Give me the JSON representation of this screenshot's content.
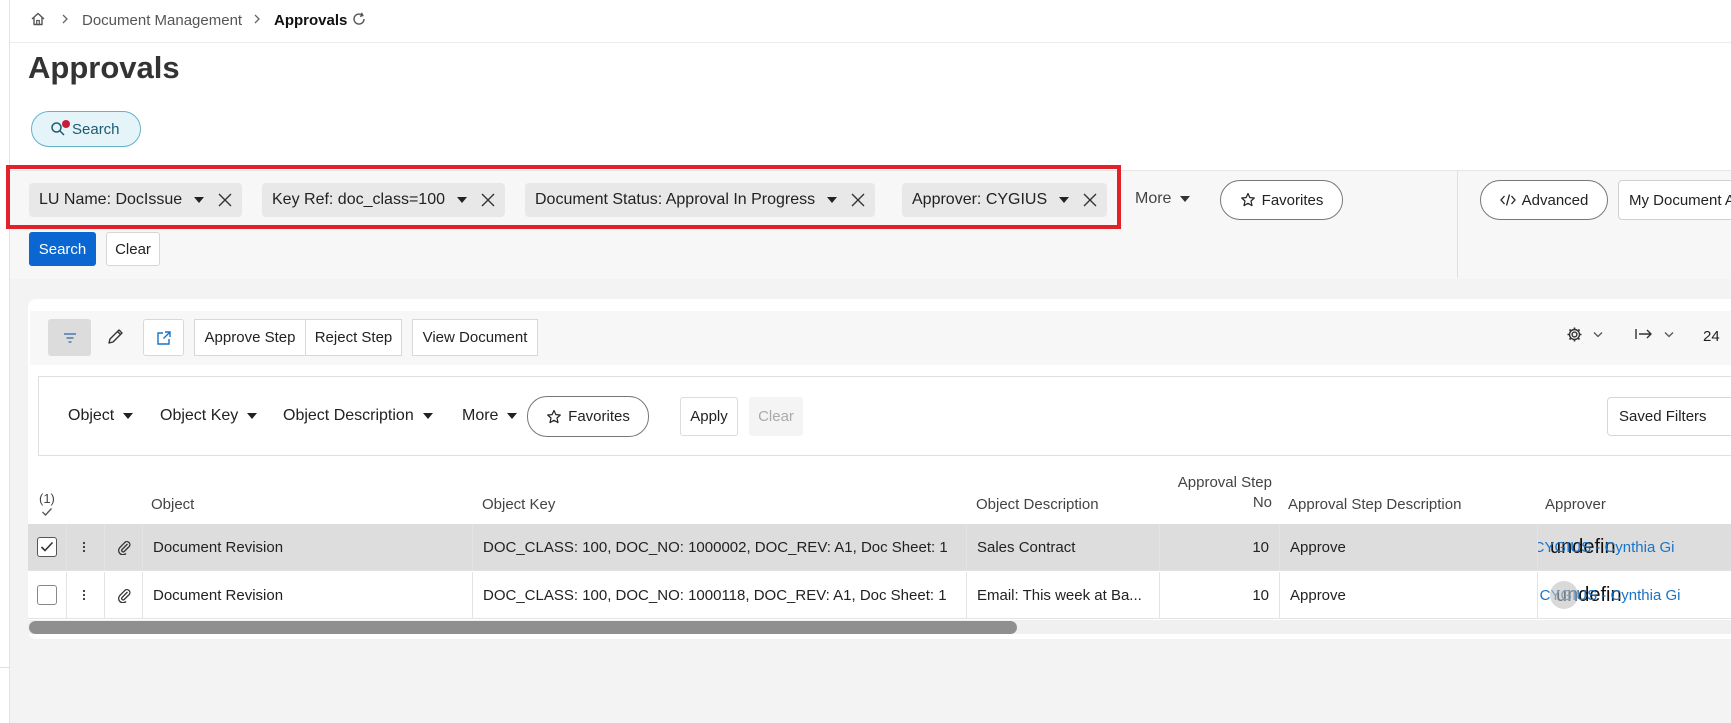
{
  "breadcrumb": {
    "home_icon": "home-icon",
    "items": [
      "Document Management",
      "Approvals"
    ],
    "refresh_icon": "refresh-icon"
  },
  "page": {
    "title": "Approvals"
  },
  "search_toggle": {
    "label": "Search",
    "has_indicator": true
  },
  "filters": {
    "chips": [
      {
        "label": "LU Name: DocIssue"
      },
      {
        "label": "Key Ref: doc_class=100"
      },
      {
        "label": "Document Status: Approval In Progress"
      },
      {
        "label": "Approver: CYGIUS"
      }
    ],
    "more_label": "More",
    "favorites_label": "Favorites",
    "advanced_label": "Advanced",
    "my_document_label": "My Document A",
    "search_label": "Search",
    "clear_label": "Clear"
  },
  "toolbar": {
    "approve_step": "Approve Step",
    "reject_step": "Reject Step",
    "view_document": "View Document",
    "record_count": "24"
  },
  "table_filters": {
    "dropdowns": [
      "Object",
      "Object Key",
      "Object Description",
      "More"
    ],
    "favorites_label": "Favorites",
    "apply_label": "Apply",
    "clear_label": "Clear",
    "saved_filters_label": "Saved Filters"
  },
  "table": {
    "selected_count": "(1)",
    "columns": {
      "object": "Object",
      "object_key": "Object Key",
      "object_description": "Object Description",
      "approval_step_no_line1": "Approval Step",
      "approval_step_no_line2": "No",
      "approval_step_description": "Approval Step Description",
      "approver": "Approver"
    },
    "rows": [
      {
        "selected": true,
        "object": "Document Revision",
        "object_key": "DOC_CLASS: 100, DOC_NO: 1000002, DOC_REV: A1, Doc Sheet: 1",
        "object_description": "Sales Contract",
        "approval_step_no": "10",
        "approval_step_description": "Approve",
        "approver_image_alt": "undefin",
        "approver_link": "CYGIUS - Cynthia Gi"
      },
      {
        "selected": false,
        "object": "Document Revision",
        "object_key": "DOC_CLASS: 100, DOC_NO: 1000118, DOC_REV: A1, Doc Sheet: 1",
        "object_description": "Email: This week at Ba...",
        "approval_step_no": "10",
        "approval_step_description": "Approve",
        "approver_image_alt": "undefin",
        "approver_link": "CYGIUS - Cynthia Gi"
      }
    ]
  },
  "colors": {
    "primary": "#0a66d1",
    "highlight_box": "#e2212b",
    "link": "#1a73c6",
    "search_toggle_bg": "#e4f4f8"
  }
}
